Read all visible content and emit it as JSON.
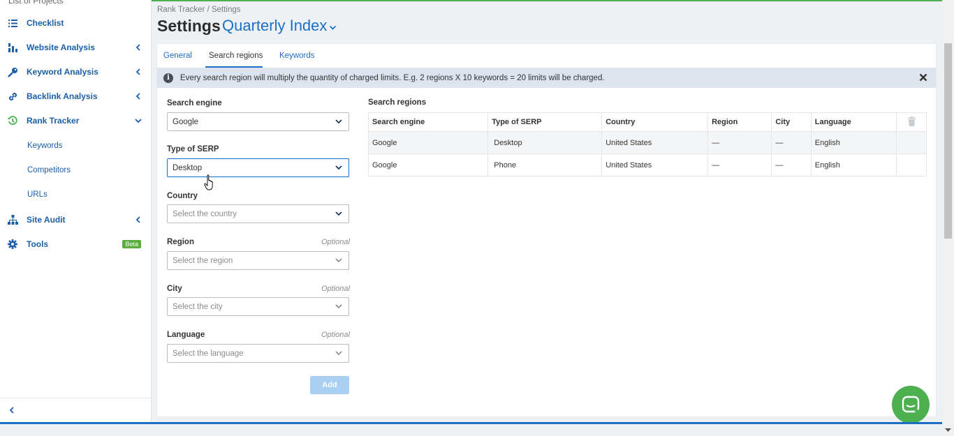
{
  "sidebar": {
    "cut_item": "List of Projects",
    "items": [
      {
        "label": "Checklist",
        "icon": "list-icon"
      },
      {
        "label": "Website Analysis",
        "icon": "chart-icon"
      },
      {
        "label": "Keyword Analysis",
        "icon": "key-icon"
      },
      {
        "label": "Backlink Analysis",
        "icon": "link-icon"
      },
      {
        "label": "Rank Tracker",
        "icon": "history-icon"
      },
      {
        "label": "Site Audit",
        "icon": "sitemap-icon"
      },
      {
        "label": "Tools",
        "icon": "gear-icon",
        "badge": "Beta"
      }
    ],
    "sub_items": [
      "Keywords",
      "Competitors",
      "URLs"
    ]
  },
  "header": {
    "breadcrumb": "Rank Tracker / Settings",
    "title": "Settings",
    "project": "Quarterly Index"
  },
  "tabs": [
    "General",
    "Search regions",
    "Keywords"
  ],
  "info": {
    "text": "Every search region will multiply the quantity of charged limits. E.g. 2 regions X 10 keywords = 20 limits will be charged."
  },
  "form": {
    "engine_label": "Search engine",
    "engine_value": "Google",
    "serp_label": "Type of SERP",
    "serp_value": "Desktop",
    "country_label": "Country",
    "country_placeholder": "Select the country",
    "region_label": "Region",
    "region_placeholder": "Select the region",
    "city_label": "City",
    "city_placeholder": "Select the city",
    "language_label": "Language",
    "language_placeholder": "Select the language",
    "optional": "Optional",
    "add_label": "Add"
  },
  "regions": {
    "title": "Search regions",
    "columns": [
      "Search engine",
      "Type of SERP",
      "Country",
      "Region",
      "City",
      "Language"
    ],
    "rows": [
      [
        "Google",
        "Desktop",
        "United States",
        "—",
        "—",
        "English"
      ],
      [
        "Google",
        "Phone",
        "United States",
        "—",
        "—",
        "English"
      ]
    ]
  },
  "colors": {
    "accent": "#1d6fc6",
    "brand_green": "#4caf50",
    "info_bg": "#dde4ee"
  }
}
